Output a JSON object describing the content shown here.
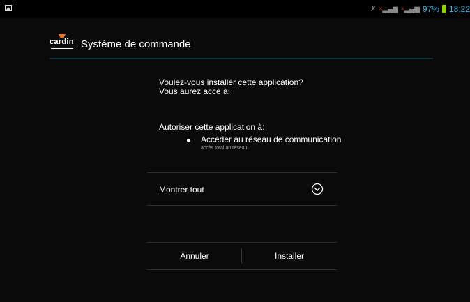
{
  "status_bar": {
    "battery": "97%",
    "time": "18:22",
    "accent_color": "#33b5e5",
    "icons": [
      "image-notification-icon",
      "mute-icon",
      "signal-icon",
      "signal-icon",
      "battery-icon"
    ]
  },
  "app": {
    "logo": "cardin",
    "title": "Systéme de commande"
  },
  "content": {
    "question_line1": "Voulez-vous installer cette application?",
    "question_line2": "Vous aurez accè à:",
    "allow_label": "Autoriser cette application à:",
    "permission_title": "Accéder au réseau de communication",
    "permission_desc": "accès total au réseau"
  },
  "show_all": {
    "label": "Montrer tout",
    "icon": "chevron-down-icon"
  },
  "buttons": {
    "cancel": "Annuler",
    "install": "Installer"
  }
}
